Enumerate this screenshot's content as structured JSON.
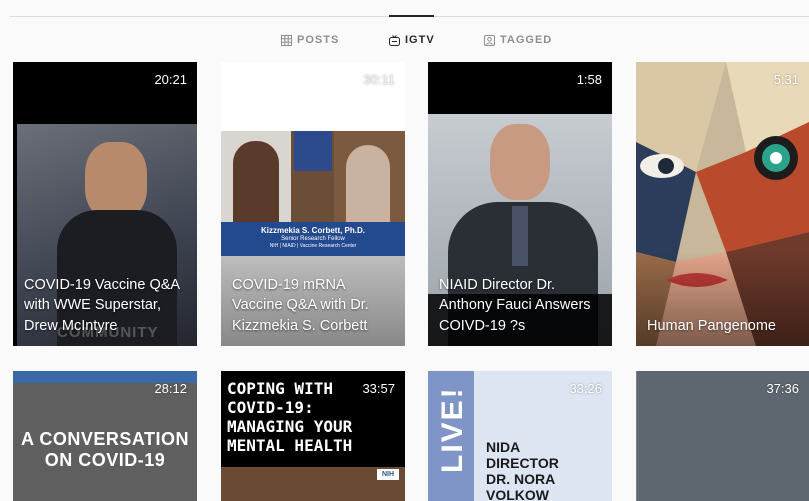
{
  "tabs": [
    {
      "label": "POSTS",
      "icon": "grid-icon",
      "active": false
    },
    {
      "label": "IGTV",
      "icon": "igtv-icon",
      "active": true
    },
    {
      "label": "TAGGED",
      "icon": "tagged-icon",
      "active": false
    }
  ],
  "videos": [
    {
      "duration": "20:21",
      "title": "COVID-19 Vaccine Q&A with WWE Superstar, Drew McIntyre",
      "logo_text": "COMMUNITY"
    },
    {
      "duration": "30:11",
      "title": "COVID-19 mRNA Vaccine Q&A with Dr. Kizzmekia S. Corbett",
      "banner_name": "Kizzmekia S. Corbett, Ph.D.",
      "banner_role": "Senior Research Fellow",
      "banner_org": "NIH | NIAID | Vaccine Research Center"
    },
    {
      "duration": "1:58",
      "title": "NIAID Director Dr. Anthony Fauci Answers COIVD-19 ?s"
    },
    {
      "duration": "5:31",
      "title": "Human Pangenome"
    },
    {
      "duration": "28:12",
      "overlay_text": "A CONVERSATION ON COVID-19"
    },
    {
      "duration": "33:57",
      "overlay_text": "COPING WITH COVID-19: MANAGING YOUR MENTAL HEALTH",
      "badge": "NIH"
    },
    {
      "duration": "33:26",
      "overlay_text": "NIDA DIRECTOR DR. NORA VOLKOW",
      "side_text": "LIVE!"
    },
    {
      "duration": "37:36"
    }
  ],
  "colors": {
    "tab_active": "#262626",
    "tab_inactive": "#8e8e8e",
    "divider": "#dbdbdb",
    "page_bg": "#fafafa"
  }
}
